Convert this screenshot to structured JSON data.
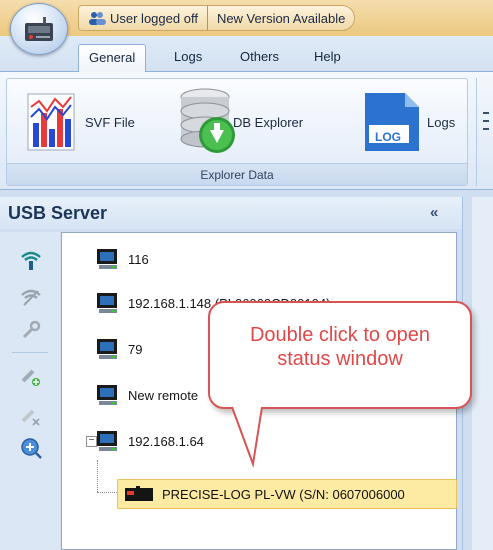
{
  "quick_access": {
    "user_status": "User logged off",
    "version_status": "New Version Available"
  },
  "tabs": [
    {
      "label": "General",
      "active": true
    },
    {
      "label": "Logs",
      "active": false
    },
    {
      "label": "Others",
      "active": false
    },
    {
      "label": "Help",
      "active": false
    }
  ],
  "ribbon": {
    "group_label": "Explorer Data",
    "buttons": {
      "svf_file": "SVF File",
      "db_explorer": "DB Explorer",
      "logs": "Logs",
      "logs_icon_text": "LOG"
    }
  },
  "panel": {
    "title": "USB Server",
    "collapse_glyph": "«",
    "toolbar_icons": [
      "wifi-connect-icon",
      "wifi-disconnect-icon",
      "wrench-icon",
      "add-server-icon",
      "remove-server-icon",
      "zoom-in-icon"
    ]
  },
  "tree": {
    "nodes": [
      {
        "label": "116"
      },
      {
        "label": "192.168.1.148 (PL06060CD00104)"
      },
      {
        "label": "79"
      },
      {
        "label": "New remote"
      },
      {
        "label": "192.168.1.64",
        "expander": "⊟"
      }
    ],
    "child": {
      "label": "PRECISE-LOG PL-VW (S/N: 0607006000"
    }
  },
  "callout": {
    "line1": "Double click to open",
    "line2": "status window"
  },
  "colors": {
    "title_strip": "#ecc97f",
    "ribbon_bg": "#dce8f6",
    "selection": "#fdeaa3",
    "callout_border": "#d85353",
    "callout_text": "#e04848"
  }
}
